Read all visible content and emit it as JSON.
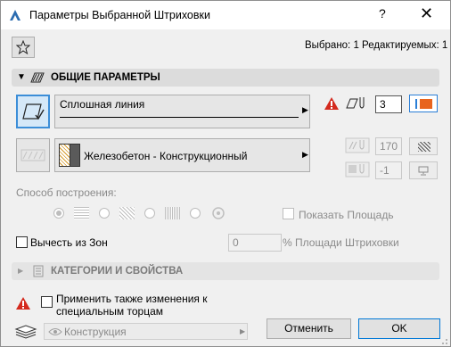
{
  "window": {
    "title": "Параметры Выбранной Штриховки",
    "help": "?",
    "close": "✕"
  },
  "selection_status": "Выбрано: 1 Редактируемых: 1",
  "general_section": {
    "label": "ОБЩИЕ ПАРАМЕТРЫ"
  },
  "line": {
    "type_label": "Сплошная линия",
    "pen_number": "3",
    "pen_color": "#e8641e"
  },
  "fill": {
    "name": "Железобетон - Конструкционный",
    "pen_value": "170",
    "background_pen_value": "-1"
  },
  "construction": {
    "label": "Способ построения:",
    "show_area_label": "Показать Площадь"
  },
  "subtract": {
    "label": "Вычесть из Зон",
    "value": "0",
    "percent_label": "% Площади Штриховки"
  },
  "categories_section": {
    "label": "КАТЕГОРИИ И СВОЙСТВА"
  },
  "apply_also": {
    "label_line1": "Применить также изменения к",
    "label_line2": "специальным торцам"
  },
  "layer": {
    "name": "Конструкция"
  },
  "buttons": {
    "cancel": "Отменить",
    "ok": "OK"
  }
}
